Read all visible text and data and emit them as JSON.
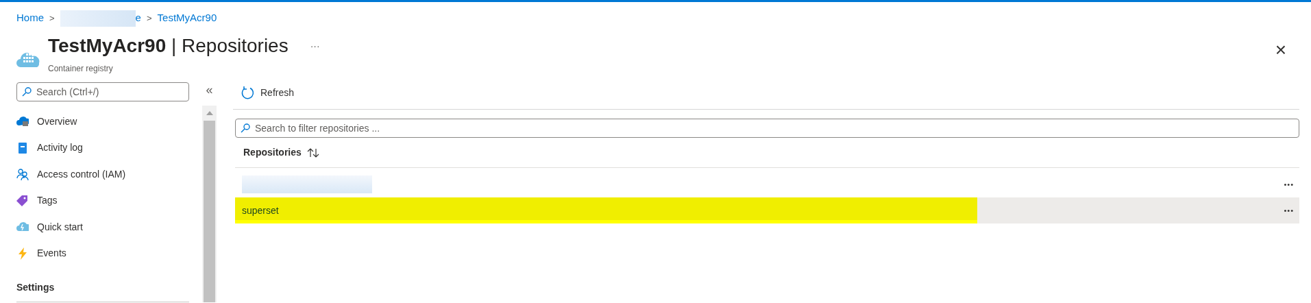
{
  "breadcrumb": [
    {
      "label": "Home",
      "redacted": false
    },
    {
      "label": "e",
      "redacted": true
    },
    {
      "label": "TestMyAcr90",
      "redacted": false
    }
  ],
  "breadcrumb_separator": ">",
  "header": {
    "resource": "TestMyAcr90",
    "divider": "|",
    "page": "Repositories",
    "subtitle": "Container registry",
    "more": "···",
    "close": "×"
  },
  "sidebar": {
    "search": {
      "placeholder": "Search (Ctrl+/)"
    },
    "collapse": "«",
    "items": [
      {
        "label": "Overview",
        "kind": "overview"
      },
      {
        "label": "Activity log",
        "kind": "log"
      },
      {
        "label": "Access control (IAM)",
        "kind": "iam"
      },
      {
        "label": "Tags",
        "kind": "tags"
      },
      {
        "label": "Quick start",
        "kind": "quickstart"
      },
      {
        "label": "Events",
        "kind": "events"
      }
    ],
    "section": "Settings"
  },
  "toolbar": {
    "refresh": "Refresh"
  },
  "filter": {
    "placeholder": "Search to filter repositories ..."
  },
  "table": {
    "column": "Repositories",
    "rows": [
      {
        "redacted": true,
        "selected": false,
        "highlighted": false,
        "more": "•••"
      },
      {
        "name": "superset",
        "redacted": false,
        "selected": true,
        "highlighted": true,
        "more": "•••"
      }
    ]
  }
}
